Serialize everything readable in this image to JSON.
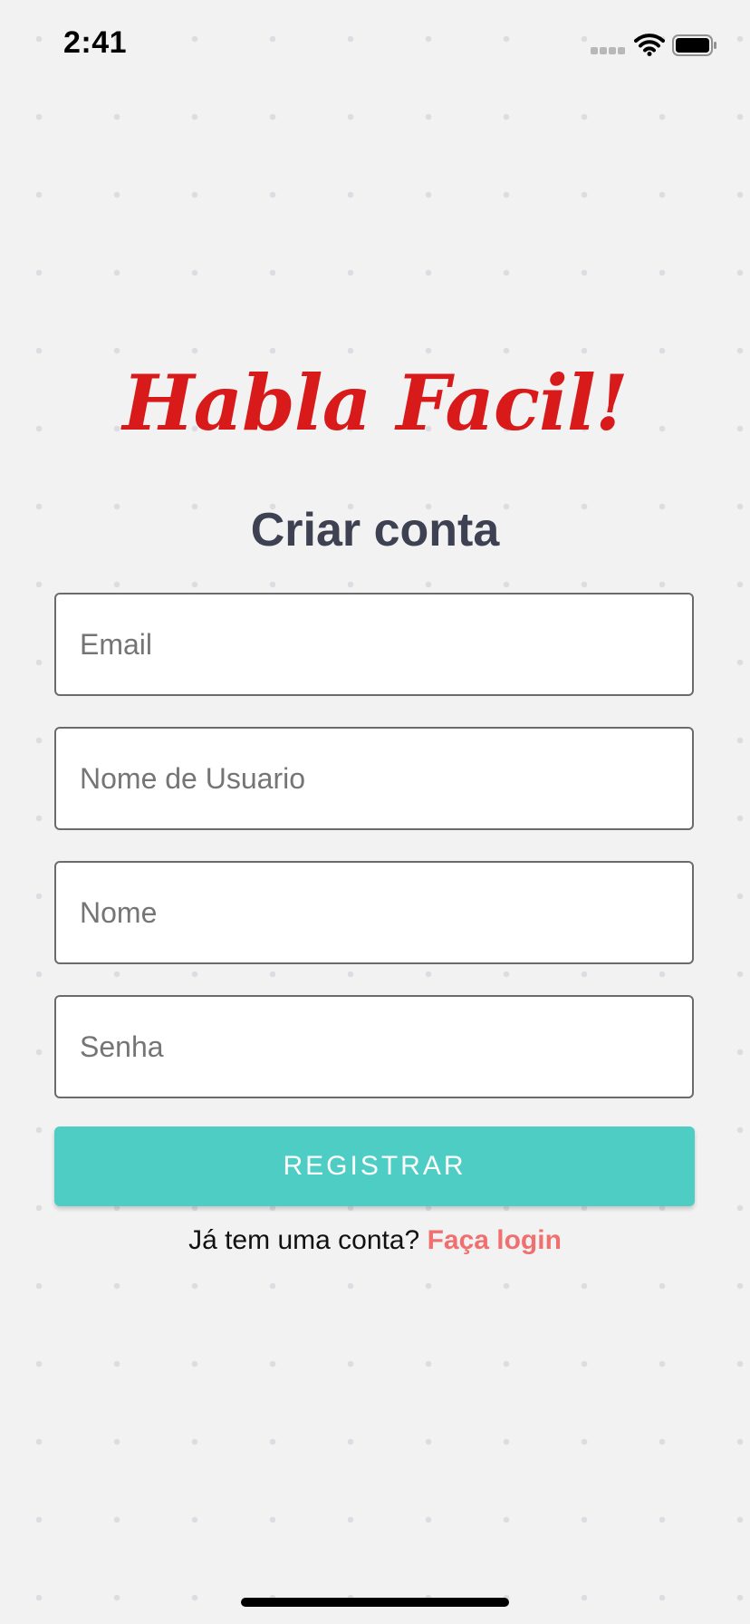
{
  "status_bar": {
    "time": "2:41"
  },
  "app": {
    "logo_text": "Habla Facil!",
    "brand_color": "#d81a1a"
  },
  "form": {
    "title": "Criar conta",
    "fields": {
      "email": {
        "value": "",
        "placeholder": "Email"
      },
      "username": {
        "value": "",
        "placeholder": "Nome de Usuario"
      },
      "name": {
        "value": "",
        "placeholder": "Nome"
      },
      "password": {
        "value": "",
        "placeholder": "Senha"
      }
    },
    "submit_label": "REGISTRAR",
    "submit_color": "#4ecdc4"
  },
  "footer": {
    "prompt": "Já tem uma conta?",
    "link_label": "Faça login",
    "link_color": "#f07070"
  },
  "icons": [
    "signal-icon",
    "wifi-icon",
    "battery-icon"
  ]
}
